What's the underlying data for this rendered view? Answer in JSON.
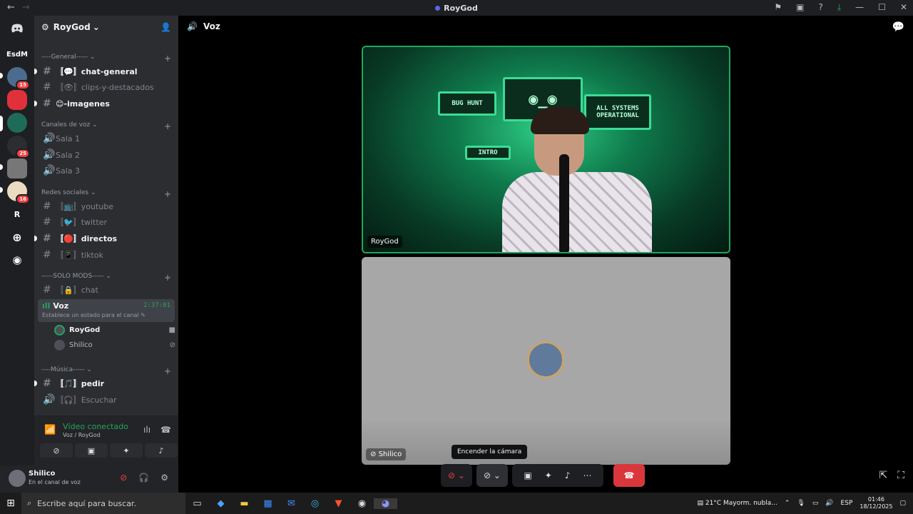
{
  "window": {
    "title": "RoyGod",
    "back": "←",
    "forward": "→"
  },
  "guilds": {
    "home_label": "",
    "text_guild": "EsdM",
    "r_guild": "R",
    "badges": [
      "15",
      "25",
      "16"
    ]
  },
  "server": {
    "name": "RoyGod",
    "chevron": "⌄"
  },
  "categories": [
    {
      "label": "----General----- ⌄"
    },
    {
      "label": "Canales de voz ⌄"
    },
    {
      "label": "Redes sociales ⌄"
    },
    {
      "label": "-----SOLO MODS----- ⌄"
    },
    {
      "label": "----Música----- ⌄"
    }
  ],
  "channels": {
    "chat_general": "〚💬〛chat-general",
    "clips": "〚👁〛clips-y-destacados",
    "imagenes": "😊-imagenes",
    "sala1": "Sala 1",
    "sala2": "Sala 2",
    "sala3": "Sala 3",
    "youtube": "〚📺〛youtube",
    "twitter": "〚🐦〛twitter",
    "directos": "〚🔴〛directos",
    "tiktok": "〚📱〛tiktok",
    "chat": "〚🔒〛chat",
    "pedir": "〚🎵〛pedir",
    "escuchar": "〚🎧〛Escuchar"
  },
  "voice_channel": {
    "name": "Voz",
    "timer": "2:37:01",
    "status": "Establece un estado para el canal ✎",
    "users": [
      "RoyGod",
      "Shilico"
    ]
  },
  "voice_panel": {
    "status": "Vídeo conectado",
    "location": "Voz / RoyGod"
  },
  "user": {
    "name": "Shilico",
    "status": "En el canal de voz"
  },
  "main": {
    "header": "Voz",
    "tiles": [
      {
        "label": "RoyGod"
      },
      {
        "label": "Shilico"
      }
    ],
    "tooltip": "Encender la cámara"
  },
  "stream_screens": [
    "BUG HUNT",
    "ALL SYSTEMS OPERATIONAL",
    "INTRO"
  ],
  "taskbar": {
    "search_placeholder": "Escribe aquí para buscar.",
    "weather": "21°C  Mayorm. nubla...",
    "lang": "ESP",
    "time": "01:46",
    "date": "18/12/2025"
  },
  "colors": {
    "accent_green": "#23a55a",
    "danger_red": "#da373c",
    "sidebar_bg": "#2b2d31",
    "rail_bg": "#1e1f22"
  }
}
